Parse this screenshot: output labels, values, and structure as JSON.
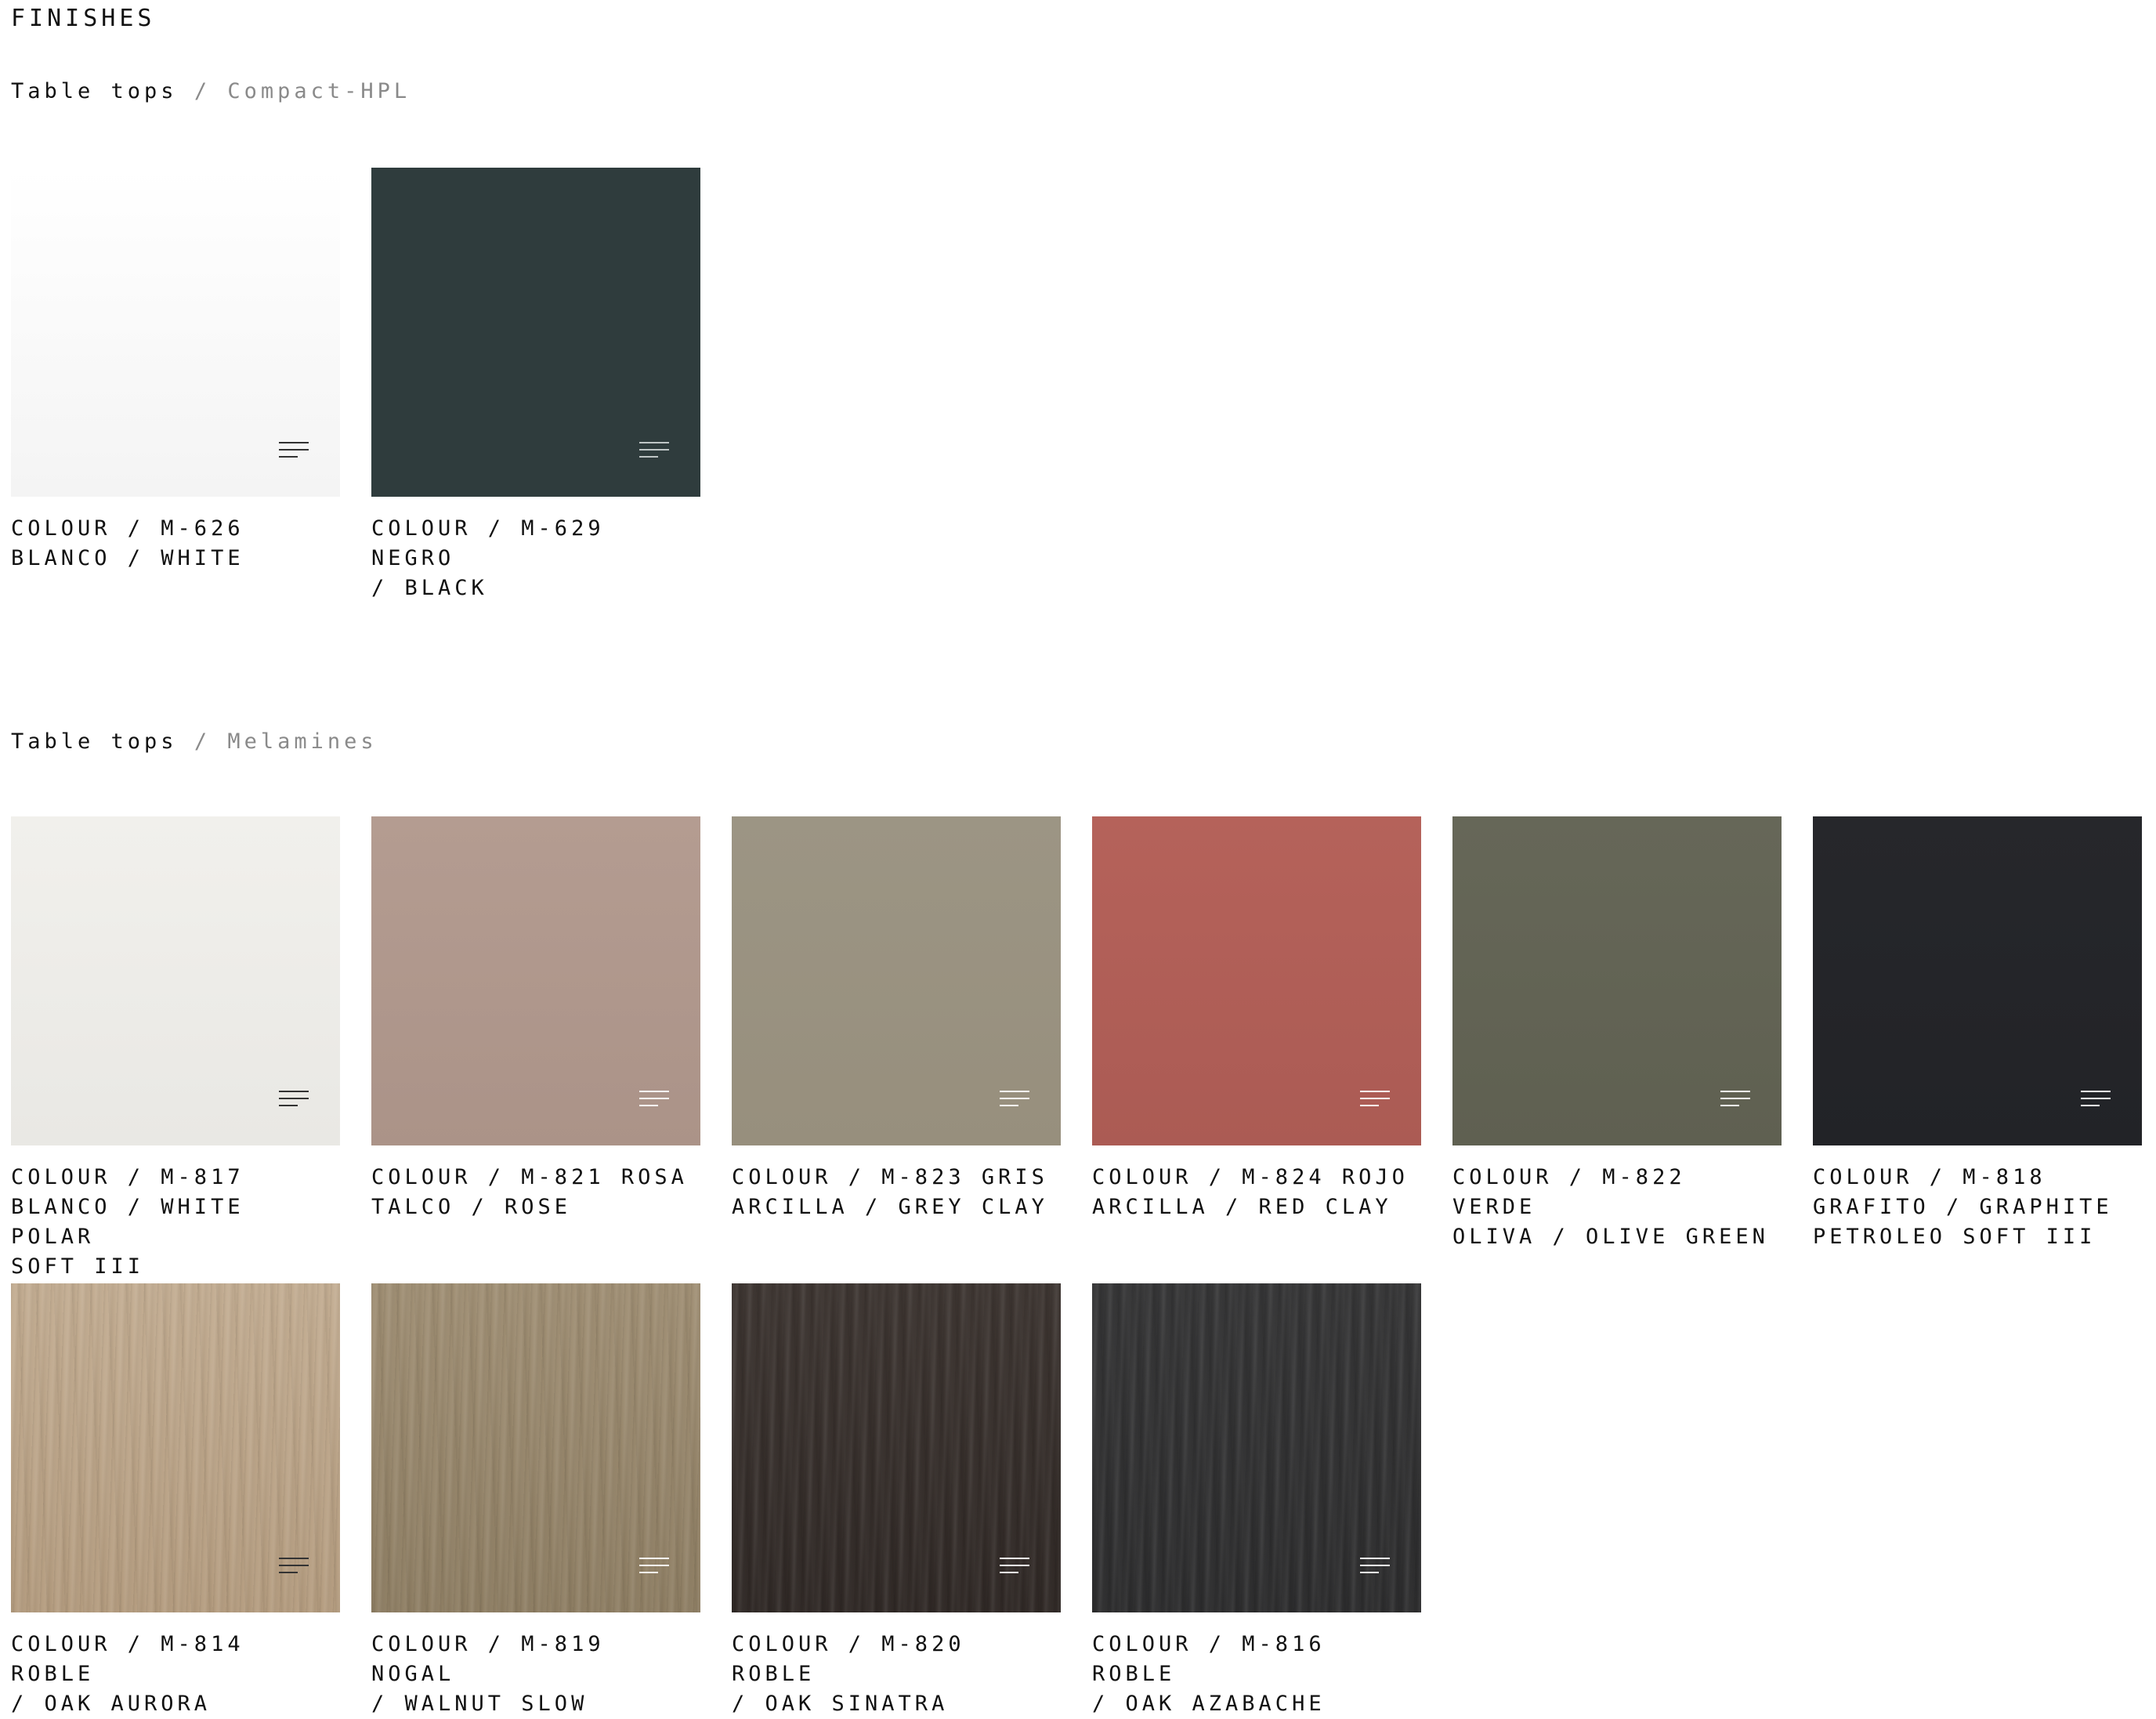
{
  "page_title": "FINISHES",
  "sections": [
    {
      "heading_main": "Table tops",
      "heading_separator": "/",
      "heading_sub": "Compact-HPL",
      "items": [
        {
          "label": "COLOUR / M-626\nBLANCO / WHITE",
          "color": "#ffffff",
          "color2": "#f4f4f4",
          "texture": "plain",
          "icon_color": "#333333"
        },
        {
          "label": "COLOUR / M-629 NEGRO\n/ BLACK",
          "color": "#2f3c3d",
          "color2": "#2f3c3d",
          "texture": "plain",
          "icon_color": "#bfc6c6"
        }
      ]
    },
    {
      "heading_main": "Table tops",
      "heading_separator": "/",
      "heading_sub": "Melamines",
      "items": [
        {
          "label": "COLOUR / M-817\nBLANCO / WHITE POLAR\nSOFT III",
          "color": "#f1f0ec",
          "color2": "#e9e8e4",
          "texture": "plain",
          "icon_color": "#333333"
        },
        {
          "label": "COLOUR / M-821 ROSA\nTALCO / ROSE",
          "color": "#b49c91",
          "color2": "#ab9388",
          "texture": "plain",
          "icon_color": "#ffffff"
        },
        {
          "label": "COLOUR / M-823 GRIS\nARCILLA / GREY CLAY",
          "color": "#9c9584",
          "color2": "#978f7d",
          "texture": "plain",
          "icon_color": "#ffffff"
        },
        {
          "label": "COLOUR / M-824 ROJO\nARCILLA / RED CLAY",
          "color": "#b5625a",
          "color2": "#ab5b54",
          "texture": "plain",
          "icon_color": "#ffffff"
        },
        {
          "label": "COLOUR / M-822 VERDE\nOLIVA / OLIVE GREEN",
          "color": "#666758",
          "color2": "#5f6051",
          "texture": "plain",
          "icon_color": "#ffffff"
        },
        {
          "label": "COLOUR / M-818\nGRAFITO / GRAPHITE\nPETROLEO SOFT III",
          "color": "#26272b",
          "color2": "#222327",
          "texture": "plain",
          "icon_color": "#ffffff"
        },
        {
          "label": "COLOUR / M-814 ROBLE\n/ OAK AURORA",
          "color": "#c3ad92",
          "color2": "#b49c7f",
          "texture": "wood",
          "icon_color": "#333333"
        },
        {
          "label": "COLOUR / M-819 NOGAL\n/ WALNUT SLOW",
          "color": "#a08f74",
          "color2": "#8e7e63",
          "texture": "wood",
          "icon_color": "#ffffff"
        },
        {
          "label": "COLOUR / M-820 ROBLE\n/ OAK SINATRA",
          "color": "#3d3531",
          "color2": "#2f2825",
          "texture": "wood",
          "icon_color": "#ffffff"
        },
        {
          "label": "COLOUR / M-816 ROBLE\n/ OAK AZABACHE",
          "color": "#353536",
          "color2": "#2c2c2d",
          "texture": "wood",
          "icon_color": "#ffffff"
        }
      ]
    }
  ]
}
